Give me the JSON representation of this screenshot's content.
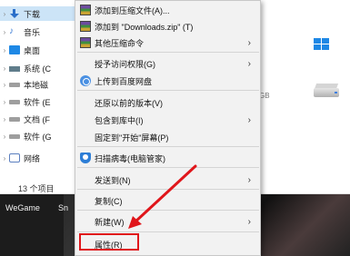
{
  "nav": {
    "items": [
      {
        "label": "下载",
        "icon": "download-icon",
        "selected": true
      },
      {
        "label": "音乐",
        "icon": "music-icon"
      },
      {
        "label": "桌面",
        "icon": "desktop-icon"
      },
      {
        "label": "系统 (C",
        "icon": "system-drive-icon"
      },
      {
        "label": "本地磁",
        "icon": "drive-icon"
      },
      {
        "label": "软件 (E",
        "icon": "drive-icon"
      },
      {
        "label": "文档 (F",
        "icon": "drive-icon"
      },
      {
        "label": "软件 (G",
        "icon": "drive-icon"
      },
      {
        "label": "网络",
        "icon": "network-icon"
      }
    ],
    "item_count": "13 个项目"
  },
  "content": {
    "size_fragment": "GB"
  },
  "taskbar": {
    "wegame": "WeGame",
    "sn": "Sn"
  },
  "context_menu": {
    "items": [
      {
        "label": "添加到压缩文件(A)...",
        "icon": "archive-icon"
      },
      {
        "label": "添加到 \"Downloads.zip\" (T)",
        "icon": "archive-icon"
      },
      {
        "label": "其他压缩命令",
        "icon": "archive-icon",
        "submenu": true
      },
      {
        "label": "授予访问权限(G)",
        "submenu": true
      },
      {
        "label": "上传到百度网盘",
        "icon": "baidu-cloud-icon"
      },
      {
        "label": "还原以前的版本(V)"
      },
      {
        "label": "包含到库中(I)",
        "submenu": true
      },
      {
        "label": "固定到\"开始\"屏幕(P)"
      },
      {
        "label": "扫描病毒(电脑管家)",
        "icon": "shield-icon"
      },
      {
        "label": "发送到(N)",
        "submenu": true
      },
      {
        "label": "复制(C)"
      },
      {
        "label": "新建(W)",
        "submenu": true
      },
      {
        "label": "属性(R)"
      }
    ],
    "highlighted_item": "属性(R)"
  },
  "colors": {
    "menu_bg": "#f2f2f2",
    "highlight": "#e0161b",
    "nav_selected": "#cce4f7"
  }
}
